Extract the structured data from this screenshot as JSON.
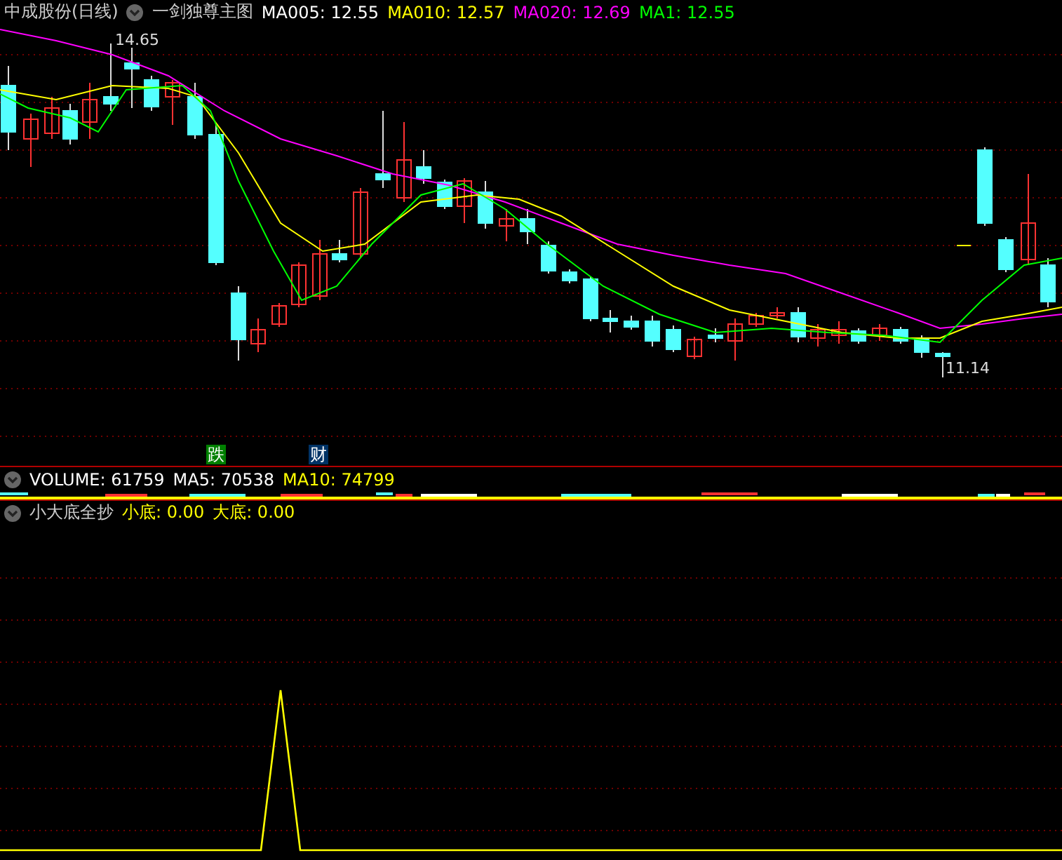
{
  "main_pane": {
    "title": "中成股份(日线)",
    "indicator": "一剑独尊主图",
    "legend": [
      {
        "text": "MA005: 12.55",
        "color": "#ffffff"
      },
      {
        "text": "MA010: 12.57",
        "color": "#ffff00"
      },
      {
        "text": "MA020: 12.69",
        "color": "#ff00ff"
      },
      {
        "text": "MA1: 12.55",
        "color": "#00ff00"
      }
    ],
    "price_labels": [
      {
        "kind": "high",
        "text": "14.65"
      },
      {
        "kind": "low",
        "text": "11.14"
      }
    ],
    "event_markers": [
      {
        "text": "跌",
        "color": "#008000"
      },
      {
        "text": "财",
        "color": "#003366"
      }
    ]
  },
  "volume_pane": {
    "legend": [
      {
        "text": "VOLUME: 61759",
        "color": "#ffffff"
      },
      {
        "text": "MA5: 70538",
        "color": "#ffffff"
      },
      {
        "text": "MA10: 74799",
        "color": "#ffff00"
      }
    ]
  },
  "indicator_pane": {
    "title": "小大底全抄",
    "legend": [
      {
        "text": "小底: 0.00",
        "color": "#ffff00"
      },
      {
        "text": "大底: 0.00",
        "color": "#ffff00"
      }
    ]
  }
}
